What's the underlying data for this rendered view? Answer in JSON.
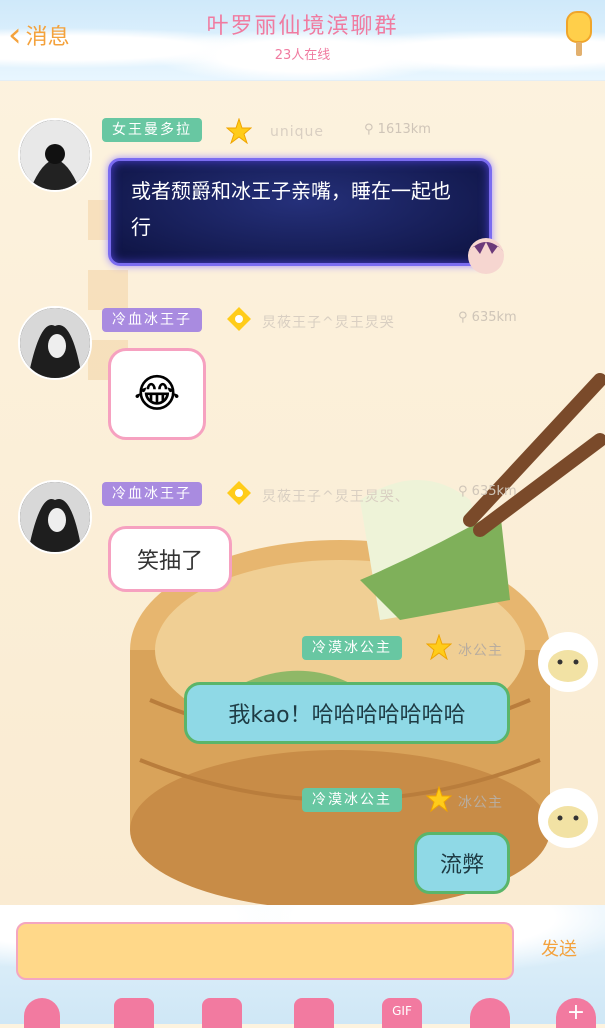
{
  "header": {
    "back_label": "消息",
    "title": "叶罗丽仙境滨聊群",
    "online": "23人在线"
  },
  "messages": [
    {
      "sender": "女王曼多拉",
      "meta_name": "unique",
      "distance": "1613km",
      "text": "或者颓爵和冰王子亲嘴，睡在一起也行"
    },
    {
      "sender": "冷血冰王子",
      "meta_name": "炅莜王子^炅王炅哭",
      "distance": "635km",
      "emoji": "😂"
    },
    {
      "sender": "冷血冰王子",
      "meta_name": "炅莜王子^炅王炅哭、",
      "distance": "635km",
      "text": "笑抽了"
    },
    {
      "sender": "冷漠冰公主",
      "meta_name": "冰公主",
      "text": "我kao！哈哈哈哈哈哈哈"
    },
    {
      "sender": "冷漠冰公主",
      "meta_name": "冰公主",
      "text": "流弊"
    }
  ],
  "composer": {
    "send_label": "发送",
    "tools": [
      "mic-icon",
      "image-icon",
      "camera-icon",
      "file-icon",
      "gif-icon",
      "emoji-icon",
      "plus-icon"
    ],
    "gif_label": "GIF"
  },
  "colors": {
    "accent_orange": "#f4a23c",
    "title_pink": "#f07ba0",
    "tag_green": "#68c7a2",
    "tag_purple": "#a98be0"
  }
}
